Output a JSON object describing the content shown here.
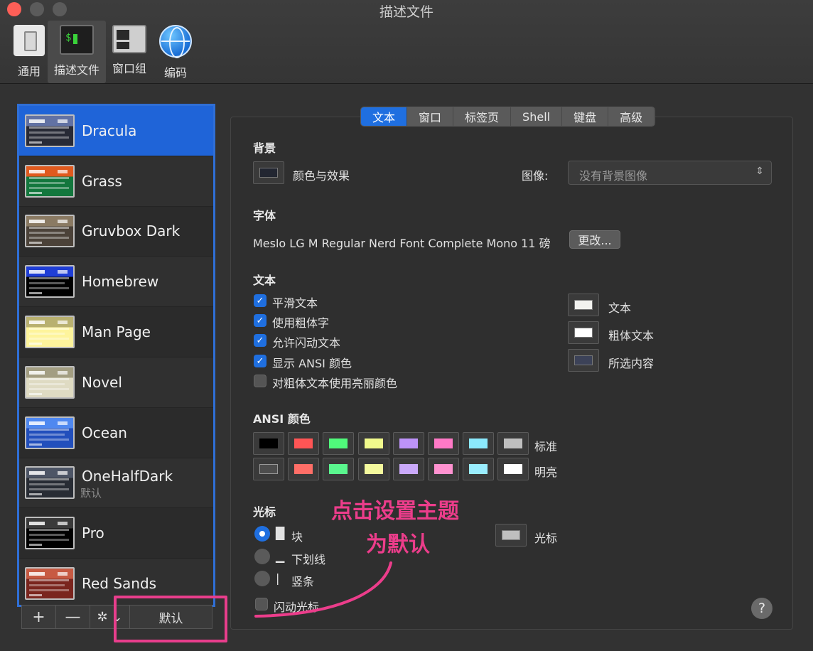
{
  "window": {
    "title": "描述文件"
  },
  "toolbar": [
    {
      "label": "通用",
      "icon": "general-icon"
    },
    {
      "label": "描述文件",
      "icon": "profiles-icon",
      "active": true
    },
    {
      "label": "窗口组",
      "icon": "window-groups-icon"
    },
    {
      "label": "编码",
      "icon": "globe-icon"
    }
  ],
  "profiles": [
    {
      "name": "Dracula",
      "colors": [
        "#282a36",
        "#6272a4"
      ],
      "selected": true,
      "sub": ""
    },
    {
      "name": "Grass",
      "colors": [
        "#13773d",
        "#e05a1e"
      ],
      "sub": ""
    },
    {
      "name": "Gruvbox Dark",
      "colors": [
        "#4b4239",
        "#8a7a63"
      ],
      "sub": ""
    },
    {
      "name": "Homebrew",
      "colors": [
        "#000000",
        "#1f3ed6"
      ],
      "sub": ""
    },
    {
      "name": "Man Page",
      "colors": [
        "#fef49c",
        "#b8b070"
      ],
      "sub": ""
    },
    {
      "name": "Novel",
      "colors": [
        "#dfdbc3",
        "#a39e82"
      ],
      "sub": ""
    },
    {
      "name": "Ocean",
      "colors": [
        "#224fbc",
        "#4f88f0"
      ],
      "sub": ""
    },
    {
      "name": "OneHalfDark",
      "colors": [
        "#282c34",
        "#4d5566"
      ],
      "sub": "默认"
    },
    {
      "name": "Pro",
      "colors": [
        "#000000",
        "#3a3a3a"
      ],
      "sub": ""
    },
    {
      "name": "Red Sands",
      "colors": [
        "#7a251e",
        "#c75a43"
      ],
      "sub": ""
    }
  ],
  "list_buttons": {
    "add": "+",
    "remove": "—",
    "gear": "✲ ⌄",
    "default": "默认"
  },
  "tabs": [
    {
      "label": "文本",
      "active": true
    },
    {
      "label": "窗口"
    },
    {
      "label": "标签页"
    },
    {
      "label": "Shell"
    },
    {
      "label": "键盘"
    },
    {
      "label": "高级"
    }
  ],
  "background": {
    "heading": "背景",
    "color_label": "颜色与效果",
    "image_label": "图像:",
    "image_value": "没有背景图像",
    "swatch": "#222631"
  },
  "font": {
    "heading": "字体",
    "value": "Meslo LG M Regular Nerd Font Complete Mono 11 磅",
    "change_button": "更改..."
  },
  "text": {
    "heading": "文本",
    "options": [
      {
        "label": "平滑文本",
        "checked": true
      },
      {
        "label": "使用粗体字",
        "checked": true
      },
      {
        "label": "允许闪动文本",
        "checked": true
      },
      {
        "label": "显示 ANSI 颜色",
        "checked": true
      },
      {
        "label": "对粗体文本使用亮丽颜色",
        "checked": false
      }
    ],
    "colors": [
      {
        "label": "文本",
        "color": "#f2f2ef"
      },
      {
        "label": "粗体文本",
        "color": "#ffffff"
      },
      {
        "label": "所选内容",
        "color": "#3c4258"
      }
    ]
  },
  "ansi": {
    "heading": "ANSI 颜色",
    "normal_label": "标准",
    "bright_label": "明亮",
    "normal": [
      "#000000",
      "#ff5555",
      "#50fa7b",
      "#f1fa8c",
      "#bd93f9",
      "#ff79c6",
      "#8be9fd",
      "#bfbfbf"
    ],
    "bright": [
      "#4d4d4d",
      "#ff6e67",
      "#5af78e",
      "#f4f99d",
      "#caa9fa",
      "#ff92d0",
      "#9aedfe",
      "#ffffff"
    ]
  },
  "cursor": {
    "heading": "光标",
    "options": [
      {
        "label": "块",
        "glyph": "█",
        "selected": true
      },
      {
        "label": "下划线",
        "glyph": "▁",
        "selected": false
      },
      {
        "label": "竖条",
        "glyph": "|",
        "selected": false
      }
    ],
    "blink_label": "闪动光标",
    "blink_checked": false,
    "color_label": "光标",
    "color": "#bfbfbf"
  },
  "annotation": {
    "line1": "点击设置主题",
    "line2": "为默认",
    "color": "#ec3d8b"
  },
  "help": "?"
}
